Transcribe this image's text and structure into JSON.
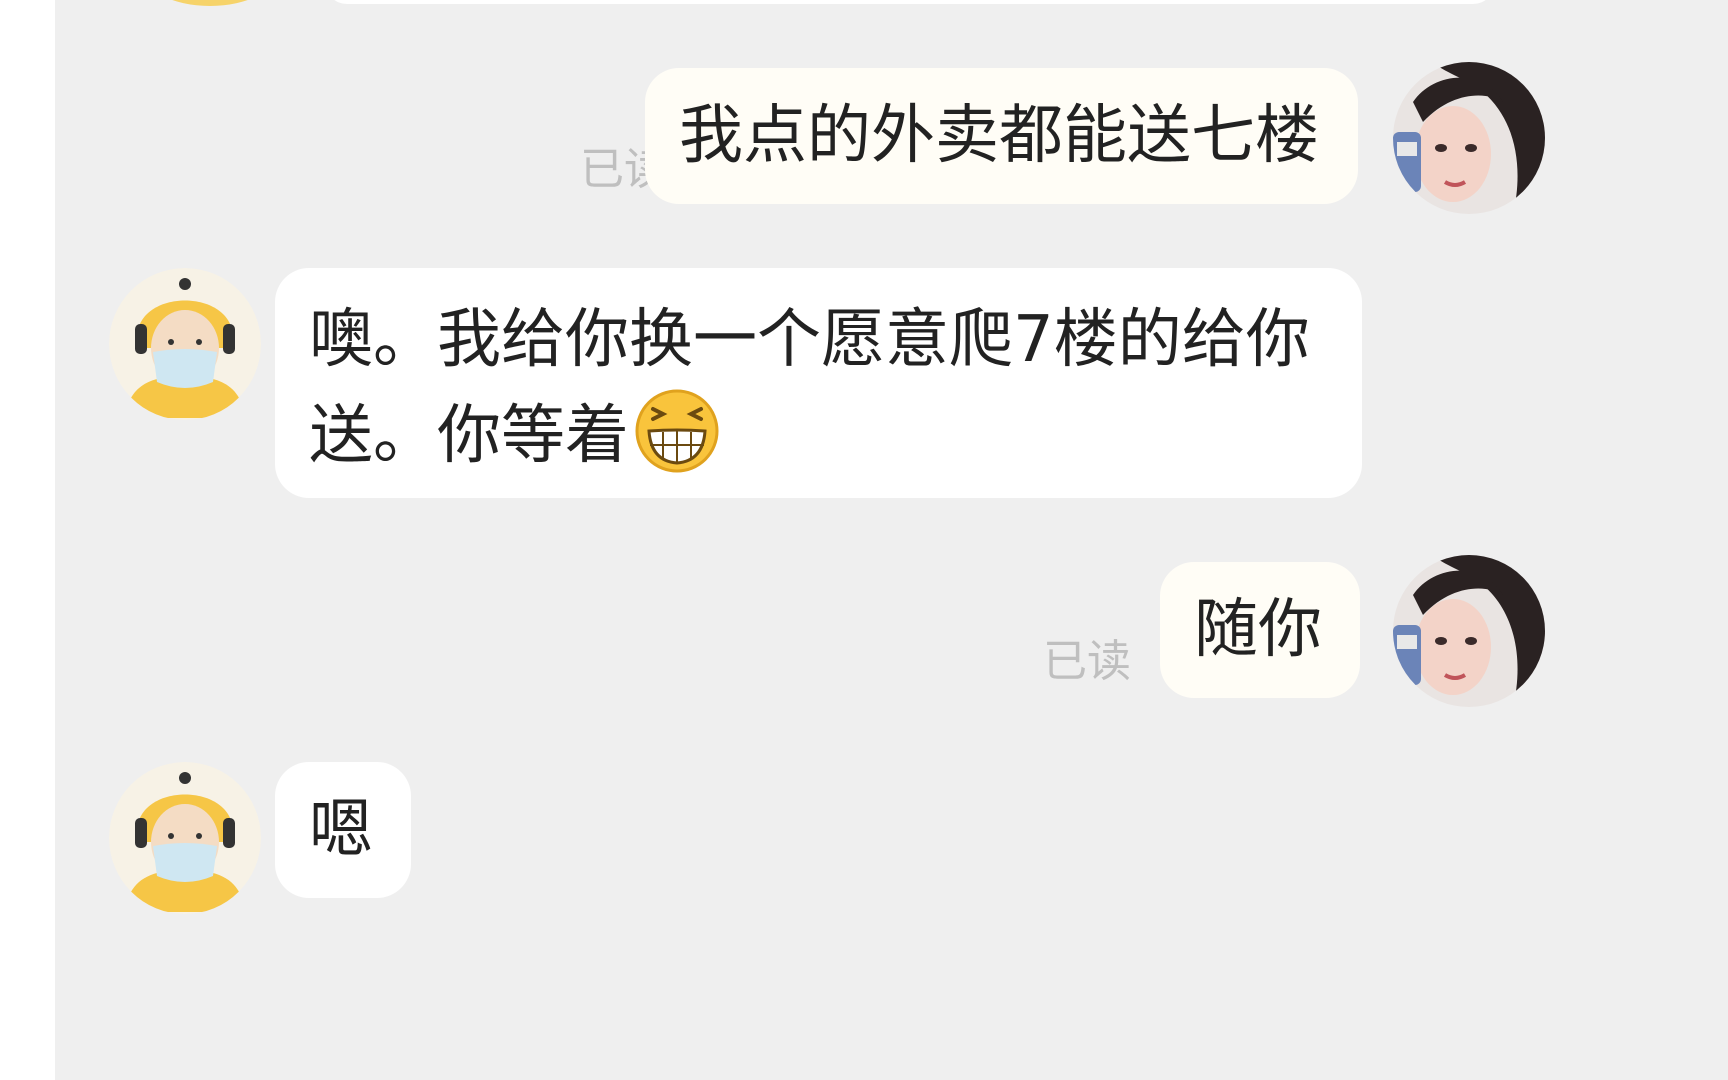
{
  "messages": [
    {
      "side": "out",
      "text": "我点的外卖都能送七楼",
      "status": "已读"
    },
    {
      "side": "in",
      "line1": "噢。我给你换一个愿意爬7楼的给你",
      "line2": "送。你等着",
      "emoji": "grinning-face-emoji"
    },
    {
      "side": "out",
      "text": "随你",
      "status": "已读"
    },
    {
      "side": "in",
      "text": "嗯"
    }
  ],
  "colors": {
    "chat_background": "#efefef",
    "incoming_bubble": "#ffffff",
    "outgoing_bubble": "#fffdf6",
    "read_status": "#bfbfbf",
    "courier_yellow": "#f6c646"
  },
  "icons": {
    "courier_avatar": "delivery-courier-avatar-icon",
    "user_avatar": "user-photo-avatar"
  }
}
